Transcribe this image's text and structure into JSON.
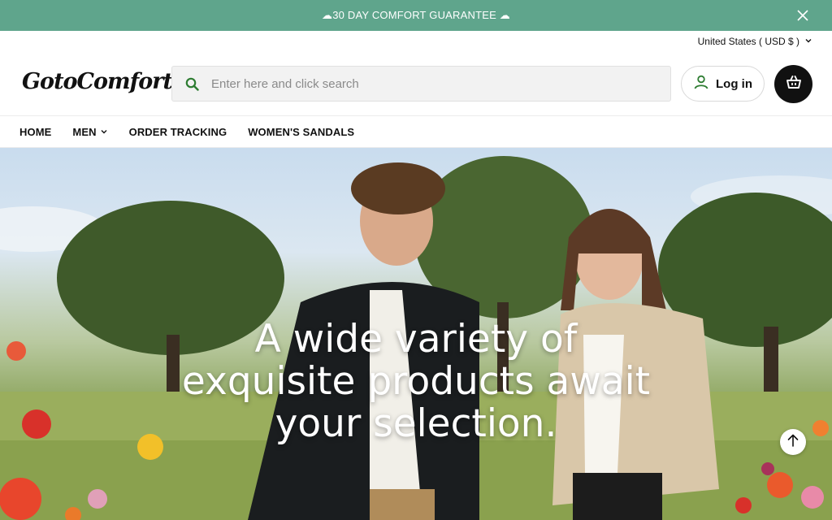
{
  "announcement": {
    "text": "☁30 DAY COMFORT GUARANTEE ☁",
    "close_icon": "close-icon"
  },
  "locale": {
    "label": "United States ( USD $ )",
    "icon": "chevron-down-icon"
  },
  "header": {
    "logo_text": "GotoComforts",
    "search_placeholder": "Enter here and click search",
    "search_value": "",
    "login_label": "Log in",
    "cart_icon": "basket-icon"
  },
  "nav": {
    "items": [
      {
        "label": "HOME"
      },
      {
        "label": "MEN"
      },
      {
        "label": "ORDER TRACKING"
      },
      {
        "label": "WOMEN'S SANDALS"
      }
    ]
  },
  "hero": {
    "title": "A wide variety of exquisite products await your selection.",
    "scroll_icon": "arrow-up-icon"
  },
  "colors": {
    "announcement_bg": "#5fa58c",
    "accent_green": "#2e7d32",
    "cart_bg": "#111111"
  }
}
